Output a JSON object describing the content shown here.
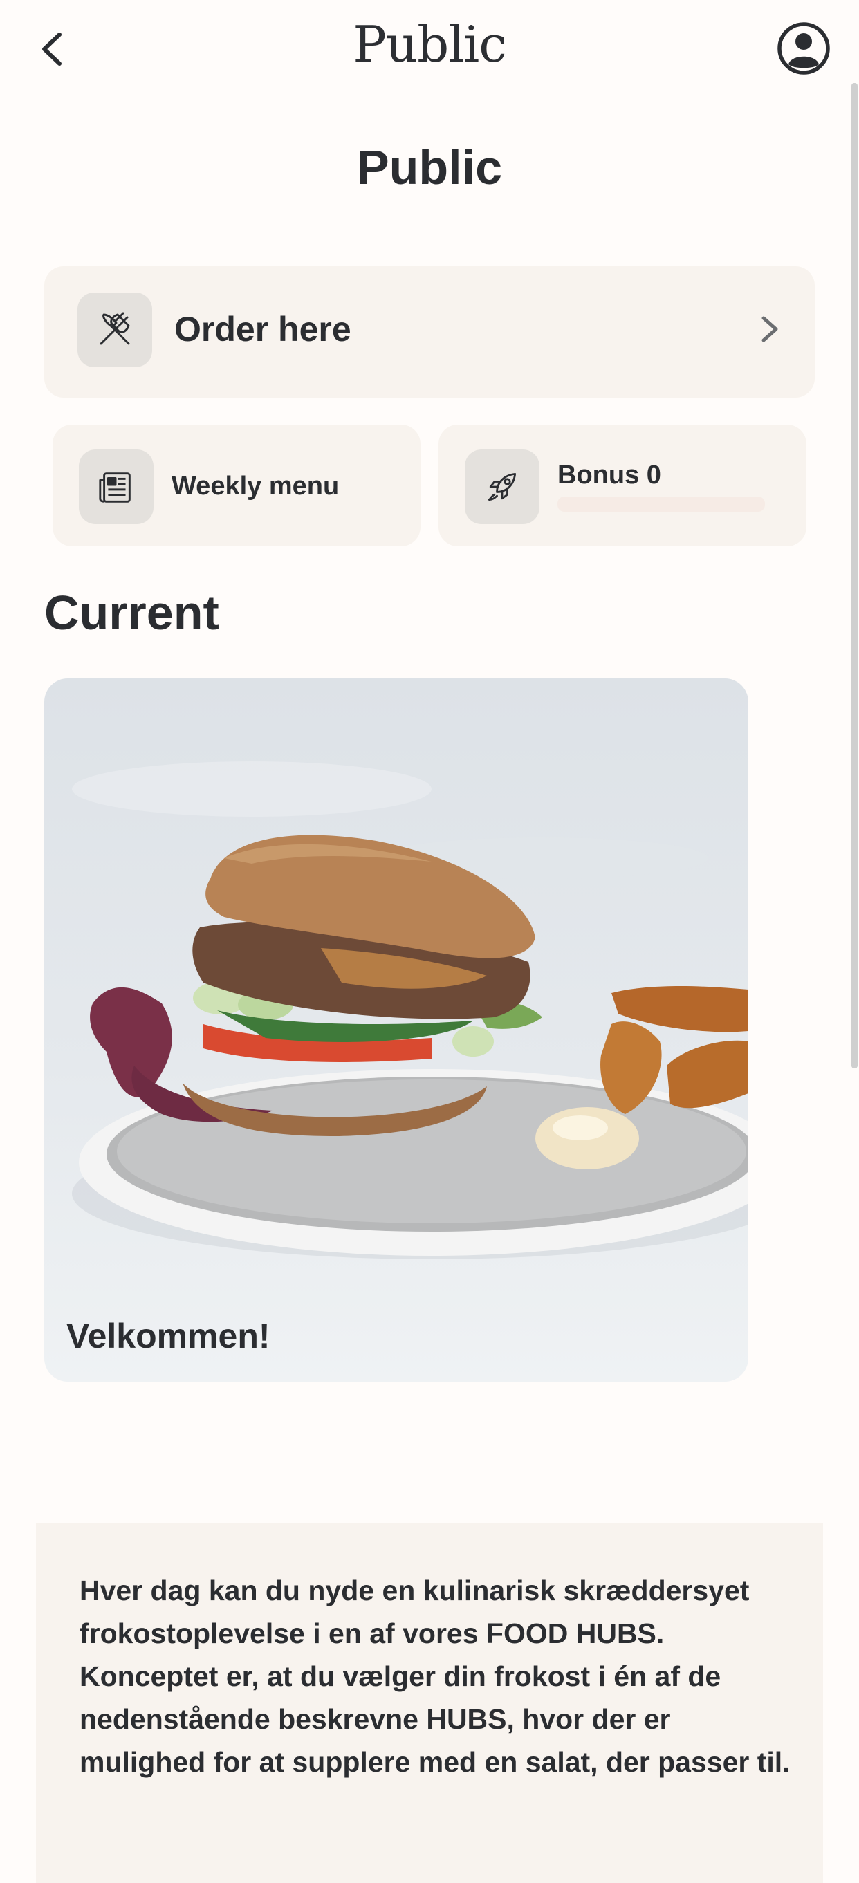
{
  "topbar": {
    "brand": "Public"
  },
  "page": {
    "title": "Public"
  },
  "order": {
    "label": "Order here"
  },
  "weekly_menu": {
    "label": "Weekly menu"
  },
  "bonus": {
    "label": "Bonus 0",
    "progress": 0.0
  },
  "section": {
    "title": "Current"
  },
  "featured": {
    "caption": "Velkommen!"
  },
  "info": {
    "paragraph1": "Hver dag kan du nyde en kulinarisk skræddersyet frokostoplevelse i en af vores FOOD HUBS.",
    "paragraph2": "Konceptet er, at du vælger din frokost i én af de nedenstående beskrevne HUBS, hvor der er mulighed for at supplere med en salat, der passer til."
  },
  "colors": {
    "background": "#fffcfa",
    "card": "#f8f3ee",
    "icon_tile": "#e4e1dd",
    "text": "#2b2d31"
  },
  "icons": [
    "chevron-left-icon",
    "user-circle-icon",
    "fork-knife-icon",
    "chevron-right-icon",
    "newspaper-icon",
    "rocket-icon"
  ]
}
